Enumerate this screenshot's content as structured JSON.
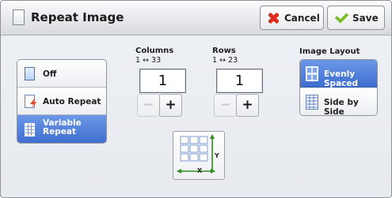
{
  "window": {
    "title": "Repeat Image",
    "title_icon": "document-icon"
  },
  "toolbar": {
    "cancel_label": "Cancel",
    "cancel_icon": "close-icon",
    "cancel_icon_color": "#e02c20",
    "save_label": "Save",
    "save_icon": "check-icon",
    "save_icon_color": "#7cbb2b"
  },
  "repeat_mode": {
    "options": [
      {
        "label": "Off",
        "icon": "document-icon",
        "selected": false
      },
      {
        "label": "Auto Repeat",
        "icon": "auto-repeat-icon",
        "selected": false
      },
      {
        "label": "Variable\nRepeat",
        "icon": "grid-document-icon",
        "selected": true
      }
    ]
  },
  "columns": {
    "heading": "Columns",
    "range": "1 ↔ 33",
    "value": "1",
    "decrement": "−",
    "increment": "+"
  },
  "rows": {
    "heading": "Rows",
    "range": "1 ↔ 23",
    "value": "1",
    "decrement": "−",
    "increment": "+"
  },
  "image_layout": {
    "heading": "Image Layout",
    "options": [
      {
        "label": "Evenly Spaced",
        "icon": "evenly-spaced-icon",
        "selected": true
      },
      {
        "label": "Side by Side",
        "icon": "side-by-side-icon",
        "selected": false
      }
    ]
  },
  "diagram": {
    "icon": "repeat-grid-diagram-icon",
    "y_label": "Y",
    "x_label": "X"
  },
  "colors": {
    "selected_bg": "#4f80dc",
    "cancel_red": "#e02c20",
    "save_green": "#7cbb2b"
  }
}
